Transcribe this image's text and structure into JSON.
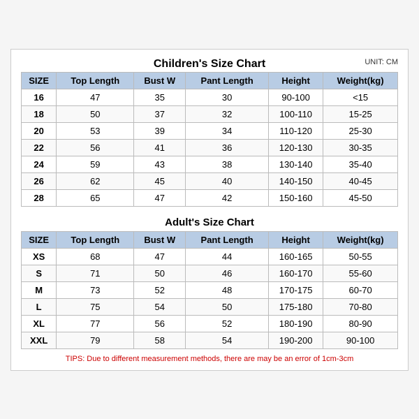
{
  "page": {
    "unit": "UNIT: CM",
    "children_title": "Children's Size Chart",
    "adult_title": "Adult's Size Chart",
    "columns": [
      "SIZE",
      "Top Length",
      "Bust W",
      "Pant Length",
      "Height",
      "Weight(kg)"
    ],
    "children_rows": [
      [
        "16",
        "47",
        "35",
        "30",
        "90-100",
        "<15"
      ],
      [
        "18",
        "50",
        "37",
        "32",
        "100-110",
        "15-25"
      ],
      [
        "20",
        "53",
        "39",
        "34",
        "110-120",
        "25-30"
      ],
      [
        "22",
        "56",
        "41",
        "36",
        "120-130",
        "30-35"
      ],
      [
        "24",
        "59",
        "43",
        "38",
        "130-140",
        "35-40"
      ],
      [
        "26",
        "62",
        "45",
        "40",
        "140-150",
        "40-45"
      ],
      [
        "28",
        "65",
        "47",
        "42",
        "150-160",
        "45-50"
      ]
    ],
    "adult_rows": [
      [
        "XS",
        "68",
        "47",
        "44",
        "160-165",
        "50-55"
      ],
      [
        "S",
        "71",
        "50",
        "46",
        "160-170",
        "55-60"
      ],
      [
        "M",
        "73",
        "52",
        "48",
        "170-175",
        "60-70"
      ],
      [
        "L",
        "75",
        "54",
        "50",
        "175-180",
        "70-80"
      ],
      [
        "XL",
        "77",
        "56",
        "52",
        "180-190",
        "80-90"
      ],
      [
        "XXL",
        "79",
        "58",
        "54",
        "190-200",
        "90-100"
      ]
    ],
    "tips": "TIPS: Due to different measurement methods, there are may be an error of 1cm-3cm"
  }
}
